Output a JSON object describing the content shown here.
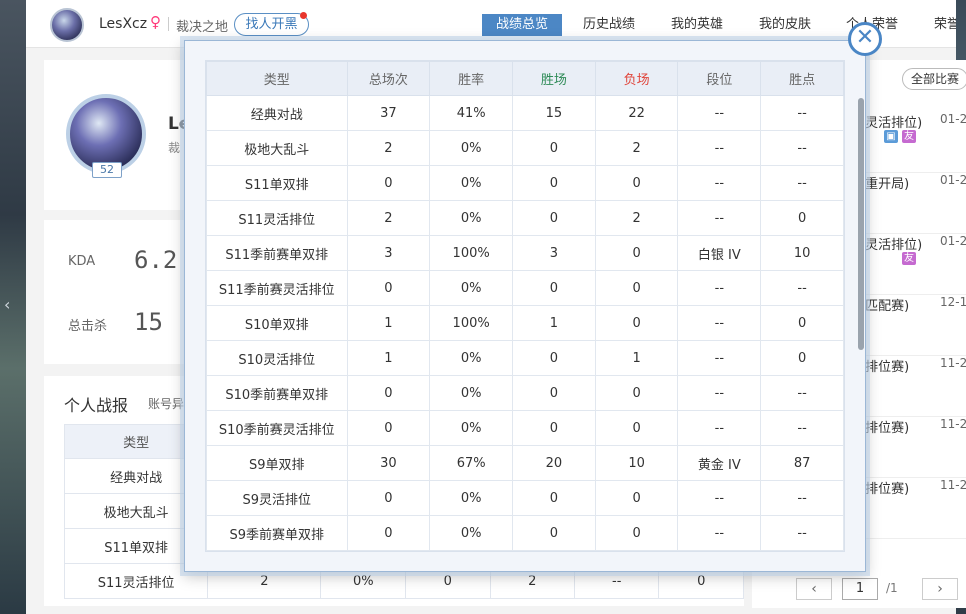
{
  "user": {
    "name": "LesXcz",
    "gender_icon": "♀",
    "server": "裁决之地",
    "find_button": "找人开黑",
    "level": "52",
    "display_name_partial": "Le",
    "sub_partial": "裁"
  },
  "nav": [
    "战绩总览",
    "历史战绩",
    "我的英雄",
    "我的皮肤",
    "个人荣誉",
    "荣誉"
  ],
  "stats": {
    "kda_label": "KDA",
    "kda_value": "6.2",
    "kills_label": "总击杀",
    "kills_value": "15"
  },
  "report": {
    "title": "个人战报",
    "subtitle": "账号异",
    "header": "类型",
    "rows": [
      {
        "type": "经典对战"
      },
      {
        "type": "极地大乱斗"
      },
      {
        "type": "S11单双排"
      },
      {
        "type": "S11灵活排位",
        "total": "2",
        "rate": "0%",
        "win": "0",
        "loss": "2",
        "rank": "--",
        "points": "0"
      }
    ]
  },
  "right_panel": {
    "all_button": "全部比赛",
    "matches": [
      {
        "mode": "(灵活排位)",
        "date": "01-2"
      },
      {
        "mode": "(重开局)",
        "date": "01-2"
      },
      {
        "mode": "(灵活排位)",
        "date": "01-2"
      },
      {
        "mode": "(匹配赛)",
        "date": "12-1"
      },
      {
        "mode": "(排位赛)",
        "date": "11-2"
      },
      {
        "mode": "(排位赛)",
        "date": "11-2"
      },
      {
        "mode": "(排位赛)",
        "date": "11-2"
      }
    ],
    "tags": {
      "friend": "友"
    },
    "page_current": "1",
    "page_total": "/1"
  },
  "modal": {
    "close_icon": "✕",
    "headers": [
      "类型",
      "总场次",
      "胜率",
      "胜场",
      "负场",
      "段位",
      "胜点"
    ],
    "rows": [
      [
        "经典对战",
        "37",
        "41%",
        "15",
        "22",
        "--",
        "--"
      ],
      [
        "极地大乱斗",
        "2",
        "0%",
        "0",
        "2",
        "--",
        "--"
      ],
      [
        "S11单双排",
        "0",
        "0%",
        "0",
        "0",
        "--",
        "--"
      ],
      [
        "S11灵活排位",
        "2",
        "0%",
        "0",
        "2",
        "--",
        "0"
      ],
      [
        "S11季前赛单双排",
        "3",
        "100%",
        "3",
        "0",
        "白银 IV",
        "10"
      ],
      [
        "S11季前赛灵活排位",
        "0",
        "0%",
        "0",
        "0",
        "--",
        "--"
      ],
      [
        "S10单双排",
        "1",
        "100%",
        "1",
        "0",
        "--",
        "0"
      ],
      [
        "S10灵活排位",
        "1",
        "0%",
        "0",
        "1",
        "--",
        "0"
      ],
      [
        "S10季前赛单双排",
        "0",
        "0%",
        "0",
        "0",
        "--",
        "--"
      ],
      [
        "S10季前赛灵活排位",
        "0",
        "0%",
        "0",
        "0",
        "--",
        "--"
      ],
      [
        "S9单双排",
        "30",
        "67%",
        "20",
        "10",
        "黄金 IV",
        "87"
      ],
      [
        "S9灵活排位",
        "0",
        "0%",
        "0",
        "0",
        "--",
        "--"
      ],
      [
        "S9季前赛单双排",
        "0",
        "0%",
        "0",
        "0",
        "--",
        "--"
      ]
    ]
  },
  "colors": {
    "accent": "#4c87c5",
    "win": "#2e8b57",
    "loss": "#e0443a",
    "gender": "#ff3a7a"
  }
}
